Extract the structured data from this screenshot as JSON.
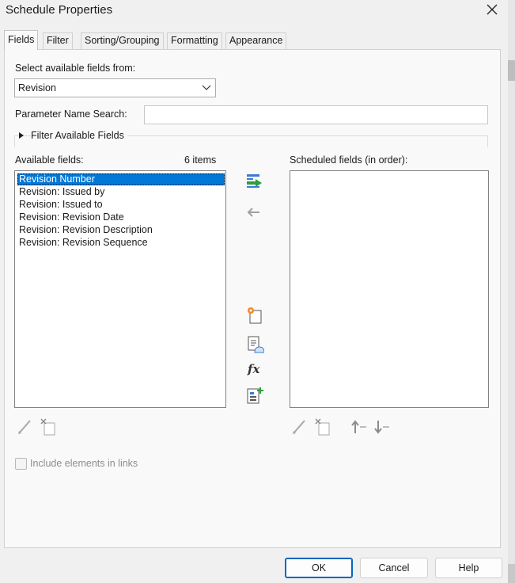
{
  "window": {
    "title": "Schedule Properties"
  },
  "tabs": [
    {
      "label": "Fields",
      "active": true
    },
    {
      "label": "Filter",
      "active": false
    },
    {
      "label": "Sorting/Grouping",
      "active": false
    },
    {
      "label": "Formatting",
      "active": false
    },
    {
      "label": "Appearance",
      "active": false
    }
  ],
  "fields_tab": {
    "select_from_label": "Select available fields from:",
    "select_from_value": "Revision",
    "param_search_label": "Parameter Name Search:",
    "param_search_value": "",
    "filter_available_label": "Filter Available Fields",
    "available_label": "Available fields:",
    "available_count": "6 items",
    "available_items": [
      "Revision Number",
      "Revision: Issued by",
      "Revision: Issued to",
      "Revision: Revision Date",
      "Revision: Revision Description",
      "Revision: Revision Sequence"
    ],
    "selected_index": 0,
    "scheduled_label": "Scheduled fields (in order):",
    "scheduled_items": [],
    "include_links_label": "Include elements in links",
    "include_links_checked": false
  },
  "icons": {
    "add": "add-parameter-icon",
    "remove": "remove-parameter-icon",
    "new_param": "new-parameter-icon",
    "add_calculated": "calculated-value-icon",
    "fx": "fx-icon",
    "combine": "combine-parameters-icon"
  },
  "buttons": {
    "ok": "OK",
    "cancel": "Cancel",
    "help": "Help"
  },
  "colors": {
    "selection": "#0078d7",
    "accent_green": "#2e9e3a",
    "primary_border": "#0067c0"
  }
}
